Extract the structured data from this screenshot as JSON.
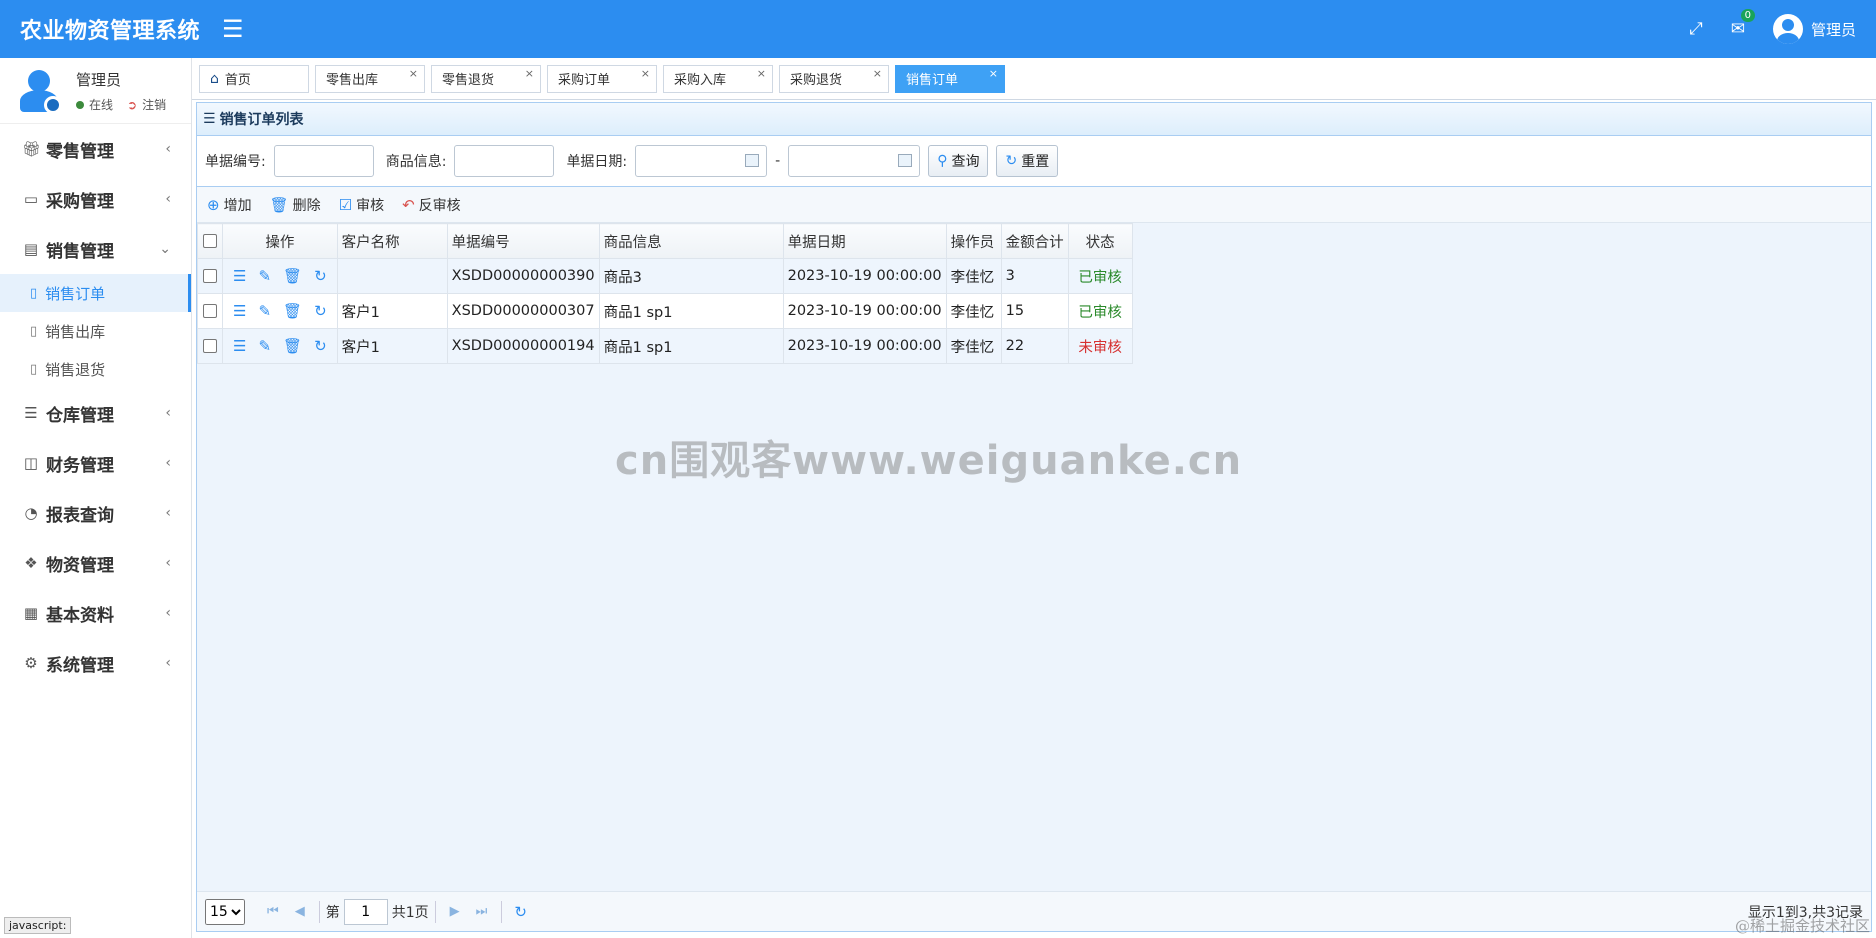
{
  "header": {
    "app_title": "农业物资管理系统",
    "menu_icon": "hamburger-icon",
    "notification_count": "0",
    "user_name": "管理员"
  },
  "sidebar": {
    "profile": {
      "name": "管理员",
      "status_online": "在线",
      "logout": "注销"
    },
    "groups": [
      {
        "label": "零售管理",
        "icon": "gift-icon"
      },
      {
        "label": "采购管理",
        "icon": "monitor-icon"
      },
      {
        "label": "销售管理",
        "icon": "briefcase-icon",
        "expanded": true,
        "items": [
          {
            "label": "销售订单",
            "active": true
          },
          {
            "label": "销售出库"
          },
          {
            "label": "销售退货"
          }
        ]
      },
      {
        "label": "仓库管理",
        "icon": "layers-icon"
      },
      {
        "label": "财务管理",
        "icon": "book-icon"
      },
      {
        "label": "报表查询",
        "icon": "pie-chart-icon"
      },
      {
        "label": "物资管理",
        "icon": "cubes-icon"
      },
      {
        "label": "基本资料",
        "icon": "grid-icon"
      },
      {
        "label": "系统管理",
        "icon": "gear-icon"
      }
    ]
  },
  "tabs": [
    {
      "label": "首页",
      "home": true
    },
    {
      "label": "零售出库"
    },
    {
      "label": "零售退货"
    },
    {
      "label": "采购订单"
    },
    {
      "label": "采购入库"
    },
    {
      "label": "采购退货"
    },
    {
      "label": "销售订单",
      "active": true
    }
  ],
  "panel": {
    "title": "销售订单列表",
    "search": {
      "bill_no_label": "单据编号:",
      "goods_label": "商品信息:",
      "date_label": "单据日期:",
      "date_sep": "-",
      "query_button": "查询",
      "reset_button": "重置"
    },
    "toolbar": {
      "add": "增加",
      "delete": "删除",
      "audit": "审核",
      "unaudit": "反审核"
    },
    "columns": [
      "操作",
      "客户名称",
      "单据编号",
      "商品信息",
      "单据日期",
      "操作员",
      "金额合计",
      "状态"
    ],
    "rows": [
      {
        "customer": "",
        "bill_no": "XSDD00000000390",
        "goods": "商品3",
        "date": "2023-10-19 00:00:00",
        "operator": "李佳忆",
        "amount": "3",
        "status": "已审核",
        "approved": true
      },
      {
        "customer": "客户1",
        "bill_no": "XSDD00000000307",
        "goods": "商品1 sp1",
        "date": "2023-10-19 00:00:00",
        "operator": "李佳忆",
        "amount": "15",
        "status": "已审核",
        "approved": true
      },
      {
        "customer": "客户1",
        "bill_no": "XSDD00000000194",
        "goods": "商品1 sp1",
        "date": "2023-10-19 00:00:00",
        "operator": "李佳忆",
        "amount": "22",
        "status": "未审核",
        "approved": false
      }
    ],
    "pager": {
      "page_size": "15",
      "page_prefix": "第",
      "page_value": "1",
      "page_suffix": "共1页",
      "info": "显示1到3,共3记录"
    }
  },
  "watermark": "cn围观客www.weiguanke.cn",
  "footer_mark": "@稀土掘金技术社区",
  "statusbar": "javascript:"
}
